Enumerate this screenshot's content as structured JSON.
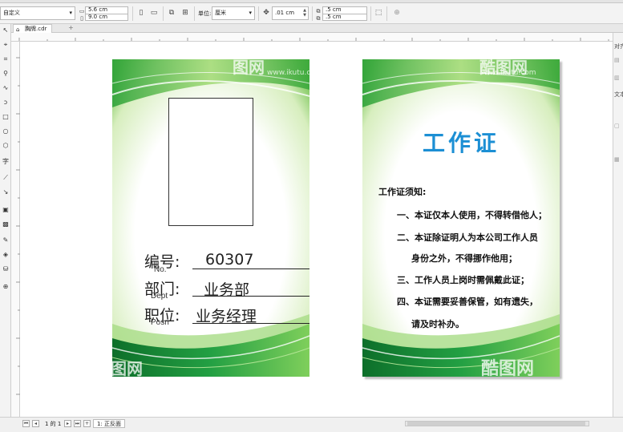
{
  "property_bar": {
    "preset": "自定义",
    "width": "5.6 cm",
    "height": "9.0 cm",
    "units_label": "单位:",
    "units_value": "厘米",
    "nudge": ".01 cm",
    "dup_x": ".5 cm",
    "dup_y": ".5 cm"
  },
  "document_tab": {
    "label": "胸牌.cdr"
  },
  "docker": {
    "label_top": "对齐",
    "label_mid": "文本"
  },
  "card_left": {
    "watermark_top": "图网",
    "watermark_url": "www.ikutu.com",
    "watermark_bottom": "图网",
    "fields": [
      {
        "label": "编号:",
        "sub": "No.",
        "value": "60307"
      },
      {
        "label": "部门:",
        "sub": "Dept",
        "value": "业务部"
      },
      {
        "label": "职位:",
        "sub": "Posn",
        "value": "业务经理"
      }
    ]
  },
  "card_right": {
    "watermark_top": "酷图网",
    "watermark_url": "www.ikutu.com",
    "watermark_bottom": "酷图网",
    "title": "工作证",
    "notice_heading": "工作证须知:",
    "items": [
      "一、本证仅本人使用，不得转借他人；",
      "二、本证除证明人为本公司工作人员",
      "身份之外，不得挪作他用；",
      "三、工作人员上岗时需佩戴此证；",
      "四、本证需要妥善保管，如有遗失，",
      "请及时补办。"
    ]
  },
  "status_bar": {
    "page_info": "1 的 1",
    "page_tab": "1: 正反面"
  },
  "colors": {
    "green_dark": "#0f8a2c",
    "green_light": "#8ed25a",
    "title_blue": "#1c8fd4"
  }
}
